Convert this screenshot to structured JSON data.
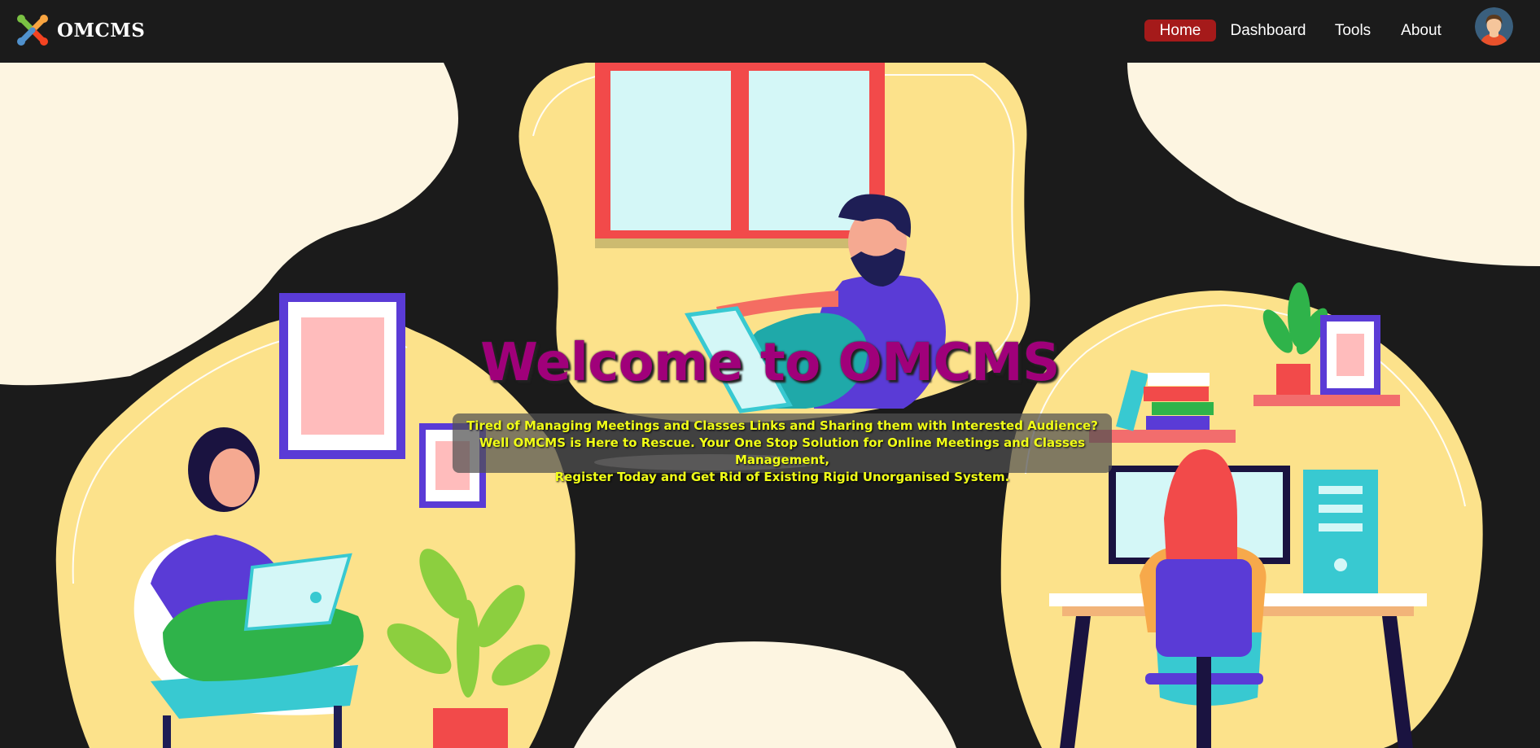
{
  "brand": {
    "name": "OMCMS",
    "logo_icon": "joomla-style-logo-icon"
  },
  "nav": {
    "items": [
      {
        "label": "Home",
        "active": true
      },
      {
        "label": "Dashboard",
        "active": false
      },
      {
        "label": "Tools",
        "active": false
      },
      {
        "label": "About",
        "active": false
      }
    ],
    "active_color": "#a51a1a",
    "avatar_icon": "user-avatar-icon"
  },
  "hero": {
    "title": "Welcome to OMCMS",
    "title_color": "#a0007a",
    "tagline": [
      "Tired of Managing Meetings and Classes Links and Sharing them with Interested Audience?",
      "Well OMCMS is Here to Rescue. Your One Stop Solution for Online Meetings and Classes Management,",
      "Register Today and Get Rid of Existing Rigid Unorganised System."
    ],
    "tagline_color": "#f1ff17",
    "illustration": "people-working-on-laptops-illustration"
  }
}
